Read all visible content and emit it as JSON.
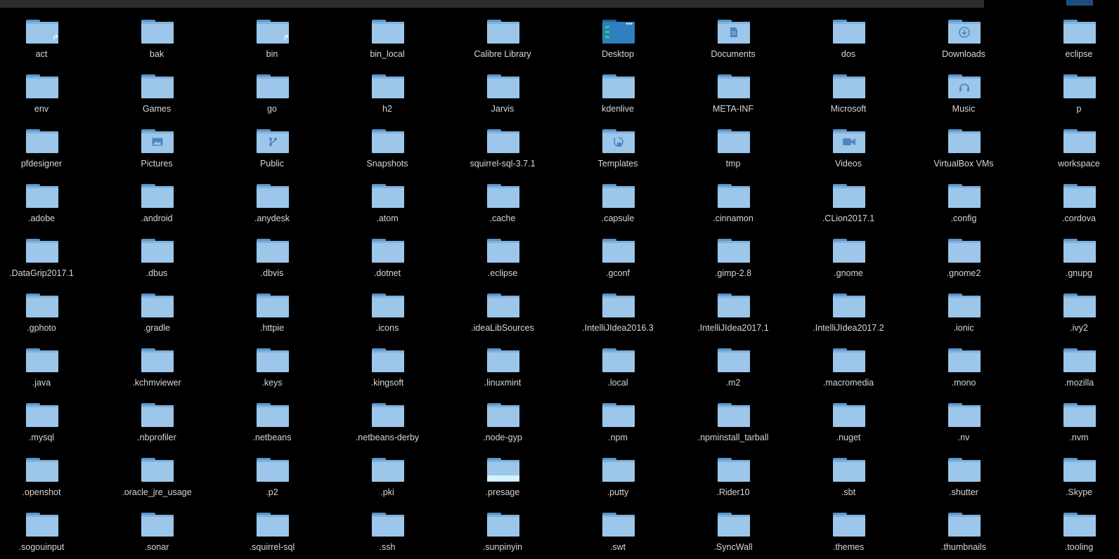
{
  "colors": {
    "background": "#000000",
    "folder_body": "#9cc7ea",
    "folder_tab": "#5b94c7",
    "label_text": "#d6d6d6",
    "emblem": "#4f86bd"
  },
  "rows": [
    [
      {
        "name": "act",
        "icon": "folder-icon",
        "link": true
      },
      {
        "name": "bak",
        "icon": "folder-icon"
      },
      {
        "name": "bin",
        "icon": "folder-icon",
        "link": true
      },
      {
        "name": "bin_local",
        "icon": "folder-icon"
      },
      {
        "name": "Calibre Library",
        "icon": "folder-icon"
      },
      {
        "name": "Desktop",
        "icon": "desktop-folder-icon"
      },
      {
        "name": "Documents",
        "icon": "documents-folder-icon"
      },
      {
        "name": "dos",
        "icon": "folder-icon"
      },
      {
        "name": "Downloads",
        "icon": "downloads-folder-icon"
      },
      {
        "name": "eclipse",
        "icon": "folder-icon"
      }
    ],
    [
      {
        "name": "env",
        "icon": "folder-icon"
      },
      {
        "name": "Games",
        "icon": "folder-icon"
      },
      {
        "name": "go",
        "icon": "folder-icon"
      },
      {
        "name": "h2",
        "icon": "folder-icon"
      },
      {
        "name": "Jarvis",
        "icon": "folder-icon"
      },
      {
        "name": "kdenlive",
        "icon": "folder-icon"
      },
      {
        "name": "META-INF",
        "icon": "folder-icon"
      },
      {
        "name": "Microsoft",
        "icon": "folder-icon"
      },
      {
        "name": "Music",
        "icon": "music-folder-icon"
      },
      {
        "name": "p",
        "icon": "folder-icon"
      }
    ],
    [
      {
        "name": "pfdesigner",
        "icon": "folder-icon"
      },
      {
        "name": "Pictures",
        "icon": "pictures-folder-icon"
      },
      {
        "name": "Public",
        "icon": "public-folder-icon"
      },
      {
        "name": "Snapshots",
        "icon": "folder-icon"
      },
      {
        "name": "squirrel-sql-3.7.1",
        "icon": "folder-icon"
      },
      {
        "name": "Templates",
        "icon": "templates-folder-icon"
      },
      {
        "name": "tmp",
        "icon": "folder-icon"
      },
      {
        "name": "Videos",
        "icon": "videos-folder-icon"
      },
      {
        "name": "VirtualBox VMs",
        "icon": "folder-icon"
      },
      {
        "name": "workspace",
        "icon": "folder-icon"
      }
    ],
    [
      {
        "name": ".adobe",
        "icon": "folder-icon"
      },
      {
        "name": ".android",
        "icon": "folder-icon"
      },
      {
        "name": ".anydesk",
        "icon": "folder-icon"
      },
      {
        "name": ".atom",
        "icon": "folder-icon"
      },
      {
        "name": ".cache",
        "icon": "folder-icon"
      },
      {
        "name": ".capsule",
        "icon": "folder-icon"
      },
      {
        "name": ".cinnamon",
        "icon": "folder-icon"
      },
      {
        "name": ".CLion2017.1",
        "icon": "folder-icon"
      },
      {
        "name": ".config",
        "icon": "folder-icon"
      },
      {
        "name": ".cordova",
        "icon": "folder-icon"
      }
    ],
    [
      {
        "name": ".DataGrip2017.1",
        "icon": "folder-icon"
      },
      {
        "name": ".dbus",
        "icon": "folder-icon"
      },
      {
        "name": ".dbvis",
        "icon": "folder-icon"
      },
      {
        "name": ".dotnet",
        "icon": "folder-icon"
      },
      {
        "name": ".eclipse",
        "icon": "folder-icon"
      },
      {
        "name": ".gconf",
        "icon": "folder-icon"
      },
      {
        "name": ".gimp-2.8",
        "icon": "folder-icon"
      },
      {
        "name": ".gnome",
        "icon": "folder-icon"
      },
      {
        "name": ".gnome2",
        "icon": "folder-icon"
      },
      {
        "name": ".gnupg",
        "icon": "folder-icon"
      }
    ],
    [
      {
        "name": ".gphoto",
        "icon": "folder-icon"
      },
      {
        "name": ".gradle",
        "icon": "folder-icon"
      },
      {
        "name": ".httpie",
        "icon": "folder-icon"
      },
      {
        "name": ".icons",
        "icon": "folder-icon"
      },
      {
        "name": ".ideaLibSources",
        "icon": "folder-icon"
      },
      {
        "name": ".IntelliJIdea2016.3",
        "icon": "folder-icon"
      },
      {
        "name": ".IntelliJIdea2017.1",
        "icon": "folder-icon"
      },
      {
        "name": ".IntelliJIdea2017.2",
        "icon": "folder-icon"
      },
      {
        "name": ".ionic",
        "icon": "folder-icon"
      },
      {
        "name": ".ivy2",
        "icon": "folder-icon"
      }
    ],
    [
      {
        "name": ".java",
        "icon": "folder-icon"
      },
      {
        "name": ".kchmviewer",
        "icon": "folder-icon"
      },
      {
        "name": ".keys",
        "icon": "folder-icon"
      },
      {
        "name": ".kingsoft",
        "icon": "folder-icon"
      },
      {
        "name": ".linuxmint",
        "icon": "folder-icon"
      },
      {
        "name": ".local",
        "icon": "folder-icon"
      },
      {
        "name": ".m2",
        "icon": "folder-icon"
      },
      {
        "name": ".macromedia",
        "icon": "folder-icon"
      },
      {
        "name": ".mono",
        "icon": "folder-icon"
      },
      {
        "name": ".mozilla",
        "icon": "folder-icon"
      }
    ],
    [
      {
        "name": ".mysql",
        "icon": "folder-icon"
      },
      {
        "name": ".nbprofiler",
        "icon": "folder-icon"
      },
      {
        "name": ".netbeans",
        "icon": "folder-icon"
      },
      {
        "name": ".netbeans-derby",
        "icon": "folder-icon"
      },
      {
        "name": ".node-gyp",
        "icon": "folder-icon"
      },
      {
        "name": ".npm",
        "icon": "folder-icon"
      },
      {
        "name": ".npminstall_tarball",
        "icon": "folder-icon"
      },
      {
        "name": ".nuget",
        "icon": "folder-icon"
      },
      {
        "name": ".nv",
        "icon": "folder-icon"
      },
      {
        "name": ".nvm",
        "icon": "folder-icon"
      }
    ],
    [
      {
        "name": ".openshot",
        "icon": "folder-icon"
      },
      {
        "name": ".oracle_jre_usage",
        "icon": "folder-icon"
      },
      {
        "name": ".p2",
        "icon": "folder-icon"
      },
      {
        "name": ".pki",
        "icon": "folder-icon"
      },
      {
        "name": ".presage",
        "icon": "presage-folder-icon"
      },
      {
        "name": ".putty",
        "icon": "folder-icon"
      },
      {
        "name": ".Rider10",
        "icon": "folder-icon"
      },
      {
        "name": ".sbt",
        "icon": "folder-icon"
      },
      {
        "name": ".shutter",
        "icon": "folder-icon"
      },
      {
        "name": ".Skype",
        "icon": "folder-icon"
      }
    ],
    [
      {
        "name": ".sogouinput",
        "icon": "folder-icon"
      },
      {
        "name": ".sonar",
        "icon": "folder-icon"
      },
      {
        "name": ".squirrel-sql",
        "icon": "folder-icon"
      },
      {
        "name": ".ssh",
        "icon": "folder-icon"
      },
      {
        "name": ".sunpinyin",
        "icon": "folder-icon"
      },
      {
        "name": ".swt",
        "icon": "folder-icon"
      },
      {
        "name": ".SyncWall",
        "icon": "folder-icon"
      },
      {
        "name": ".themes",
        "icon": "folder-icon"
      },
      {
        "name": ".thumbnails",
        "icon": "folder-icon"
      },
      {
        "name": ".tooling",
        "icon": "folder-icon"
      }
    ]
  ]
}
